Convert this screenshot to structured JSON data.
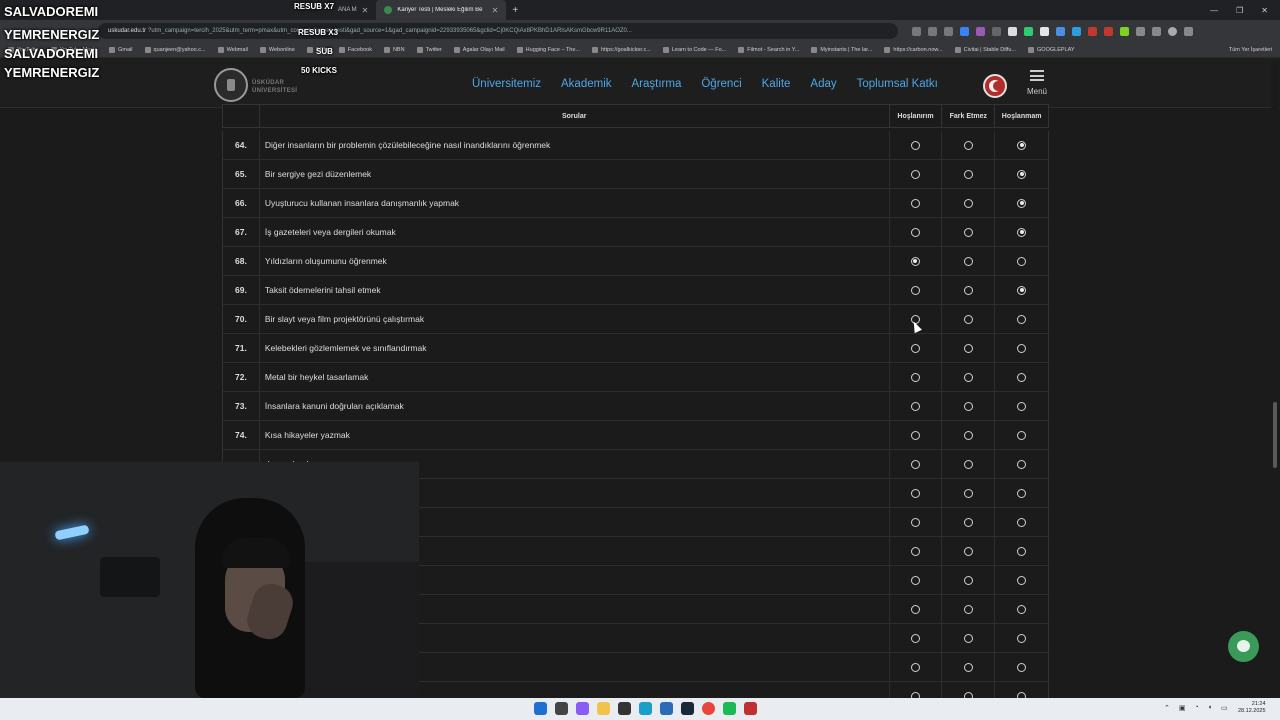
{
  "browser": {
    "tabs": [
      {
        "label": "ANA M",
        "active": false
      },
      {
        "label": "Kariyer Testi | Mesleki Eğilim Be",
        "active": true
      }
    ],
    "url_domain": "uskudar.edu.tr",
    "url_rest": "?utm_campaign=tercih_2025&utm_term=pmax&utm_content=kariyer_testi&gad_source=1&gad_campaignid=22933935065&gclid=Cj0KCQiAx8PKBhD1ARIsAKsmGbcw9R11AOZ0...",
    "bookmarks": [
      "YouTube",
      "YouTube Music",
      "Gmail",
      "quanjeen@yahoo.c...",
      "Webmail",
      "Webonline",
      "SQL",
      "Facebook",
      "NBN",
      "Twitter",
      "Agalar Olayı Mail",
      "Hugging Face – The...",
      "https://goalkicker.c...",
      "Learn to Code — Fo...",
      "Filmot - Search in Y...",
      "Myinstants | The lar...",
      "https://carbon.now...",
      "Civitai | Stable Diffu...",
      "GOOGLEPLAY"
    ],
    "bookmarks_right": "Tüm Yer İşaretleri"
  },
  "site": {
    "logo_line1": "ÜSKÜDAR",
    "logo_line2": "ÜNİVERSİTESİ",
    "nav": [
      "Üniversitemiz",
      "Akademik",
      "Araştırma",
      "Öğrenci",
      "Kalite",
      "Aday",
      "Toplumsal Katkı"
    ],
    "menu_label": "Menü"
  },
  "table": {
    "headers": {
      "questions": "Sorular",
      "like": "Hoşlanırım",
      "indifferent": "Fark Etmez",
      "dislike": "Hoşlanmam"
    },
    "rows": [
      {
        "num": "64.",
        "text": "Diğer insanların bir problemin çözülebileceğine nasıl inandıklarını öğrenmek",
        "selected": "dislike"
      },
      {
        "num": "65.",
        "text": "Bir sergiye gezi düzenlemek",
        "selected": "dislike"
      },
      {
        "num": "66.",
        "text": "Uyuşturucu kullanan insanlara danışmanlık yapmak",
        "selected": "dislike"
      },
      {
        "num": "67.",
        "text": "İş gazeteleri veya dergileri okumak",
        "selected": "dislike"
      },
      {
        "num": "68.",
        "text": "Yıldızların oluşumunu öğrenmek",
        "selected": "like"
      },
      {
        "num": "69.",
        "text": "Taksit ödemelerini tahsil etmek",
        "selected": "dislike"
      },
      {
        "num": "70.",
        "text": "Bir slayt veya film projektörünü çalıştırmak",
        "selected": "none"
      },
      {
        "num": "71.",
        "text": "Kelebekleri gözlemlemek ve sınıflandırmak",
        "selected": "none"
      },
      {
        "num": "72.",
        "text": "Metal bir heykel tasarlamak",
        "selected": "none"
      },
      {
        "num": "73.",
        "text": "İnsanlara kanuni doğruları açıklamak",
        "selected": "none"
      },
      {
        "num": "74.",
        "text": "Kısa hikayeler yazmak",
        "selected": "none"
      },
      {
        "num": "",
        "text": "dımcı olmak",
        "selected": "none"
      },
      {
        "num": "",
        "text": "",
        "selected": "none"
      },
      {
        "num": "",
        "text": "amak",
        "selected": "none"
      },
      {
        "num": "",
        "text": "tkinliklerin eleştirilerini yazmak",
        "selected": "none"
      },
      {
        "num": "",
        "text": "",
        "selected": "none"
      },
      {
        "num": "",
        "text": "ırmak",
        "selected": "none"
      },
      {
        "num": "",
        "text": "",
        "selected": "none"
      },
      {
        "num": "",
        "text": "",
        "selected": "none"
      },
      {
        "num": "",
        "text": "",
        "selected": "none"
      }
    ]
  },
  "overlay": {
    "name1": "SALVADOREMI",
    "name2": "YEMRENERGIZ",
    "name3": "SALVADOREMI",
    "name4": "YEMRENERGIZ",
    "resub1": "RESUB X7",
    "resub2": "RESUB X3",
    "sub": "SUB",
    "kicks": "50 KICKS"
  },
  "taskbar": {
    "time": "21:24",
    "date": "28.12.2025"
  }
}
